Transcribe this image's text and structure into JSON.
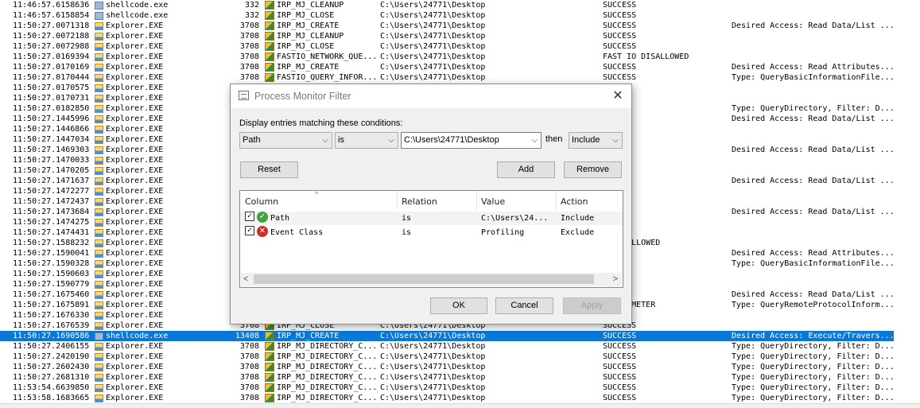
{
  "log": {
    "rows": [
      {
        "time": "11:46:57.6158636",
        "process": "shellcode.exe",
        "pid": "332",
        "operation": "IRP_MJ_CLEANUP",
        "path": "C:\\Users\\24771\\Desktop",
        "result": "SUCCESS",
        "detail": "",
        "process_icon": "exe-icon"
      },
      {
        "time": "11:46:57.6158854",
        "process": "shellcode.exe",
        "pid": "332",
        "operation": "IRP_MJ_CLOSE",
        "path": "C:\\Users\\24771\\Desktop",
        "result": "SUCCESS",
        "detail": "",
        "process_icon": "exe-icon"
      },
      {
        "time": "11:50:27.0071318",
        "process": "Explorer.EXE",
        "pid": "3708",
        "operation": "IRP_MJ_CREATE",
        "path": "C:\\Users\\24771\\Desktop",
        "result": "SUCCESS",
        "detail": "Desired Access: Read Data/List ...",
        "process_icon": "explorer-icon"
      },
      {
        "time": "11:50:27.0072188",
        "process": "Explorer.EXE",
        "pid": "3708",
        "operation": "IRP_MJ_CLEANUP",
        "path": "C:\\Users\\24771\\Desktop",
        "result": "SUCCESS",
        "detail": "",
        "process_icon": "explorer-icon"
      },
      {
        "time": "11:50:27.0072988",
        "process": "Explorer.EXE",
        "pid": "3708",
        "operation": "IRP_MJ_CLOSE",
        "path": "C:\\Users\\24771\\Desktop",
        "result": "SUCCESS",
        "detail": "",
        "process_icon": "explorer-icon"
      },
      {
        "time": "11:50:27.0169394",
        "process": "Explorer.EXE",
        "pid": "3708",
        "operation": "FASTIO_NETWORK_QUE...",
        "path": "C:\\Users\\24771\\Desktop",
        "result": "FAST IO DISALLOWED",
        "detail": "",
        "process_icon": "explorer-icon"
      },
      {
        "time": "11:50:27.0170169",
        "process": "Explorer.EXE",
        "pid": "3708",
        "operation": "IRP_MJ_CREATE",
        "path": "C:\\Users\\24771\\Desktop",
        "result": "SUCCESS",
        "detail": "Desired Access: Read Attributes...",
        "process_icon": "explorer-icon"
      },
      {
        "time": "11:50:27.0170444",
        "process": "Explorer.EXE",
        "pid": "3708",
        "operation": "FASTIO_QUERY_INFOR...",
        "path": "C:\\Users\\24771\\Desktop",
        "result": "SUCCESS",
        "detail": "Type: QueryBasicInformationFile...",
        "process_icon": "explorer-icon"
      },
      {
        "time": "11:50:27.0170575",
        "process": "Explorer.EXE",
        "pid": "",
        "operation": "",
        "path": "",
        "result": "",
        "detail": "",
        "process_icon": "explorer-icon"
      },
      {
        "time": "11:50:27.0170731",
        "process": "Explorer.EXE",
        "pid": "",
        "operation": "",
        "path": "",
        "result": "",
        "detail": "",
        "process_icon": "explorer-icon"
      },
      {
        "time": "11:50:27.0182850",
        "process": "Explorer.EXE",
        "pid": "",
        "operation": "",
        "path": "",
        "result": "",
        "detail": "Type: QueryDirectory, Filter: D...",
        "process_icon": "explorer-icon"
      },
      {
        "time": "11:50:27.1445996",
        "process": "Explorer.EXE",
        "pid": "",
        "operation": "",
        "path": "",
        "result": "",
        "detail": "Desired Access: Read Data/List ...",
        "process_icon": "explorer-icon"
      },
      {
        "time": "11:50:27.1446866",
        "process": "Explorer.EXE",
        "pid": "",
        "operation": "",
        "path": "",
        "result": "",
        "detail": "",
        "process_icon": "explorer-icon"
      },
      {
        "time": "11:50:27.1447034",
        "process": "Explorer.EXE",
        "pid": "",
        "operation": "",
        "path": "",
        "result": "",
        "detail": "",
        "process_icon": "explorer-icon"
      },
      {
        "time": "11:50:27.1469303",
        "process": "Explorer.EXE",
        "pid": "",
        "operation": "",
        "path": "",
        "result": "",
        "detail": "Desired Access: Read Data/List ...",
        "process_icon": "explorer-icon"
      },
      {
        "time": "11:50:27.1470033",
        "process": "Explorer.EXE",
        "pid": "",
        "operation": "",
        "path": "",
        "result": "",
        "detail": "",
        "process_icon": "explorer-icon"
      },
      {
        "time": "11:50:27.1470205",
        "process": "Explorer.EXE",
        "pid": "",
        "operation": "",
        "path": "",
        "result": "",
        "detail": "",
        "process_icon": "explorer-icon"
      },
      {
        "time": "11:50:27.1471637",
        "process": "Explorer.EXE",
        "pid": "",
        "operation": "",
        "path": "",
        "result": "",
        "detail": "Desired Access: Read Data/List ...",
        "process_icon": "explorer-icon"
      },
      {
        "time": "11:50:27.1472277",
        "process": "Explorer.EXE",
        "pid": "",
        "operation": "",
        "path": "",
        "result": "",
        "detail": "",
        "process_icon": "explorer-icon"
      },
      {
        "time": "11:50:27.1472437",
        "process": "Explorer.EXE",
        "pid": "",
        "operation": "",
        "path": "",
        "result": "",
        "detail": "",
        "process_icon": "explorer-icon"
      },
      {
        "time": "11:50:27.1473684",
        "process": "Explorer.EXE",
        "pid": "",
        "operation": "",
        "path": "",
        "result": "",
        "detail": "Desired Access: Read Data/List ...",
        "process_icon": "explorer-icon"
      },
      {
        "time": "11:50:27.1474275",
        "process": "Explorer.EXE",
        "pid": "",
        "operation": "",
        "path": "",
        "result": "",
        "detail": "",
        "process_icon": "explorer-icon"
      },
      {
        "time": "11:50:27.1474431",
        "process": "Explorer.EXE",
        "pid": "",
        "operation": "",
        "path": "",
        "result": "",
        "detail": "",
        "process_icon": "explorer-icon"
      },
      {
        "time": "11:50:27.1588232",
        "process": "Explorer.EXE",
        "pid": "",
        "operation": "",
        "path": "",
        "result": "O DISALLOWED",
        "detail": "",
        "process_icon": "explorer-icon"
      },
      {
        "time": "11:50:27.1590041",
        "process": "Explorer.EXE",
        "pid": "",
        "operation": "",
        "path": "",
        "result": "",
        "detail": "Desired Access: Read Attributes...",
        "process_icon": "explorer-icon"
      },
      {
        "time": "11:50:27.1590328",
        "process": "Explorer.EXE",
        "pid": "",
        "operation": "",
        "path": "",
        "result": "",
        "detail": "Type: QueryBasicInformationFile...",
        "process_icon": "explorer-icon"
      },
      {
        "time": "11:50:27.1590603",
        "process": "Explorer.EXE",
        "pid": "",
        "operation": "",
        "path": "",
        "result": "",
        "detail": "",
        "process_icon": "explorer-icon"
      },
      {
        "time": "11:50:27.1590779",
        "process": "Explorer.EXE",
        "pid": "",
        "operation": "",
        "path": "",
        "result": "",
        "detail": "",
        "process_icon": "explorer-icon"
      },
      {
        "time": "11:50:27.1675460",
        "process": "Explorer.EXE",
        "pid": "",
        "operation": "",
        "path": "",
        "result": "",
        "detail": "Desired Access: Read Data/List ...",
        "process_icon": "explorer-icon"
      },
      {
        "time": "11:50:27.1675891",
        "process": "Explorer.EXE",
        "pid": "",
        "operation": "",
        "path": "",
        "result": "D PARAMETER",
        "detail": "Type: QueryRemoteProtocolInform...",
        "process_icon": "explorer-icon"
      },
      {
        "time": "11:50:27.1676330",
        "process": "Explorer.EXE",
        "pid": "",
        "operation": "",
        "path": "",
        "result": "",
        "detail": "",
        "process_icon": "explorer-icon"
      },
      {
        "time": "11:50:27.1676539",
        "process": "Explorer.EXE",
        "pid": "3708",
        "operation": "IRP_MJ_CLOSE",
        "path": "C:\\Users\\24771\\Desktop",
        "result": "SUCCESS",
        "detail": "",
        "process_icon": "explorer-icon"
      },
      {
        "time": "11:50:27.1690586",
        "process": "shellcode.exe",
        "pid": "13408",
        "operation": "IRP_MJ_CREATE",
        "path": "C:\\Users\\24771\\Desktop",
        "result": "SUCCESS",
        "detail": "Desired Access: Execute/Travers...",
        "process_icon": "exe-icon",
        "selected": true
      },
      {
        "time": "11:50:27.2406155",
        "process": "Explorer.EXE",
        "pid": "3708",
        "operation": "IRP_MJ_DIRECTORY_C...",
        "path": "C:\\Users\\24771\\Desktop",
        "result": "SUCCESS",
        "detail": "Type: QueryDirectory, Filter: D...",
        "process_icon": "explorer-icon"
      },
      {
        "time": "11:50:27.2420190",
        "process": "Explorer.EXE",
        "pid": "3708",
        "operation": "IRP_MJ_DIRECTORY_C...",
        "path": "C:\\Users\\24771\\Desktop",
        "result": "SUCCESS",
        "detail": "Type: QueryDirectory, Filter: D...",
        "process_icon": "explorer-icon"
      },
      {
        "time": "11:50:27.2602430",
        "process": "Explorer.EXE",
        "pid": "3708",
        "operation": "IRP_MJ_DIRECTORY_C...",
        "path": "C:\\Users\\24771\\Desktop",
        "result": "SUCCESS",
        "detail": "Type: QueryDirectory, Filter: D...",
        "process_icon": "explorer-icon"
      },
      {
        "time": "11:50:27.2681310",
        "process": "Explorer.EXE",
        "pid": "3708",
        "operation": "IRP_MJ_DIRECTORY_C...",
        "path": "C:\\Users\\24771\\Desktop",
        "result": "SUCCESS",
        "detail": "Type: QueryDirectory, Filter: D...",
        "process_icon": "explorer-icon"
      },
      {
        "time": "11:53:54.6639850",
        "process": "Explorer.EXE",
        "pid": "3708",
        "operation": "IRP_MJ_DIRECTORY_C...",
        "path": "C:\\Users\\24771\\Desktop",
        "result": "SUCCESS",
        "detail": "Type: QueryDirectory, Filter: D...",
        "process_icon": "explorer-icon"
      },
      {
        "time": "11:53:58.1683665",
        "process": "Explorer.EXE",
        "pid": "3708",
        "operation": "IRP_MJ_DIRECTORY_C...",
        "path": "C:\\Users\\24771\\Desktop",
        "result": "SUCCESS",
        "detail": "Type: QueryDirectory, Filter: D...",
        "process_icon": "explorer-icon"
      }
    ]
  },
  "dialog": {
    "title": "Process Monitor Filter",
    "close_glyph": "✕",
    "instruction": "Display entries matching these conditions:",
    "column_select": "Path",
    "relation_select": "is",
    "value_input": "C:\\Users\\24771\\Desktop",
    "then_label": "then",
    "action_select": "Include",
    "dropdown_arrow": "⌵",
    "reset_label": "Reset",
    "add_label": "Add",
    "remove_label": "Remove",
    "list": {
      "headers": {
        "column": "Column",
        "relation": "Relation",
        "value": "Value",
        "action": "Action"
      },
      "sort_glyph": "^",
      "rules": [
        {
          "checked": true,
          "icon": "include-check-icon",
          "glyph": "✓",
          "column": "Path",
          "relation": "is",
          "value": "C:\\Users\\24...",
          "action": "Include"
        },
        {
          "checked": true,
          "icon": "exclude-x-icon",
          "glyph": "✕",
          "column": "Event Class",
          "relation": "is",
          "value": "Profiling",
          "action": "Exclude"
        }
      ],
      "scroll_left_glyph": "<",
      "scroll_right_glyph": ">"
    },
    "ok_label": "OK",
    "cancel_label": "Cancel",
    "apply_label": "Apply",
    "apply_disabled": true
  },
  "colors": {
    "selection": "#0a78d7",
    "include_icon": "#3fa33f",
    "exclude_icon": "#d22b2b"
  }
}
